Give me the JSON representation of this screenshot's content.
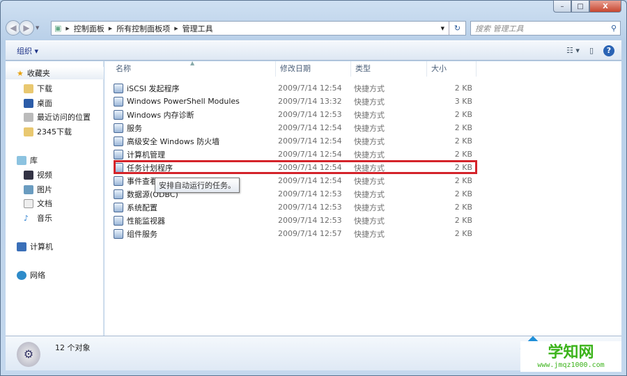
{
  "window": {
    "min": "–",
    "max": "□",
    "close": "X"
  },
  "address": {
    "crumbs": [
      "控制面板",
      "所有控制面板项",
      "管理工具"
    ],
    "search_placeholder": "搜索 管理工具"
  },
  "toolbar": {
    "organize": "组织 ▾"
  },
  "sidebar": {
    "favorites": "收藏夹",
    "fav_items": [
      "下载",
      "桌面",
      "最近访问的位置",
      "2345下载"
    ],
    "libraries": "库",
    "lib_items": [
      "视频",
      "图片",
      "文档",
      "音乐"
    ],
    "computer": "计算机",
    "network": "网络"
  },
  "columns": {
    "name": "名称",
    "date": "修改日期",
    "type": "类型",
    "size": "大小"
  },
  "files": [
    {
      "name": "iSCSI 发起程序",
      "date": "2009/7/14 12:54",
      "type": "快捷方式",
      "size": "2 KB"
    },
    {
      "name": "Windows PowerShell Modules",
      "date": "2009/7/14 13:32",
      "type": "快捷方式",
      "size": "3 KB"
    },
    {
      "name": "Windows 内存诊断",
      "date": "2009/7/14 12:53",
      "type": "快捷方式",
      "size": "2 KB"
    },
    {
      "name": "服务",
      "date": "2009/7/14 12:54",
      "type": "快捷方式",
      "size": "2 KB"
    },
    {
      "name": "高级安全 Windows 防火墙",
      "date": "2009/7/14 12:54",
      "type": "快捷方式",
      "size": "2 KB"
    },
    {
      "name": "计算机管理",
      "date": "2009/7/14 12:54",
      "type": "快捷方式",
      "size": "2 KB"
    },
    {
      "name": "任务计划程序",
      "date": "2009/7/14 12:54",
      "type": "快捷方式",
      "size": "2 KB"
    },
    {
      "name": "事件查看器",
      "date": "2009/7/14 12:54",
      "type": "快捷方式",
      "size": "2 KB"
    },
    {
      "name": "数据源(ODBC)",
      "date": "2009/7/14 12:53",
      "type": "快捷方式",
      "size": "2 KB"
    },
    {
      "name": "系统配置",
      "date": "2009/7/14 12:53",
      "type": "快捷方式",
      "size": "2 KB"
    },
    {
      "name": "性能监视器",
      "date": "2009/7/14 12:53",
      "type": "快捷方式",
      "size": "2 KB"
    },
    {
      "name": "组件服务",
      "date": "2009/7/14 12:57",
      "type": "快捷方式",
      "size": "2 KB"
    }
  ],
  "tooltip": "安排自动运行的任务。",
  "status": {
    "count": "12 个对象"
  },
  "watermark": {
    "logo": "学知网",
    "url": "www.jmqz1000.com"
  }
}
